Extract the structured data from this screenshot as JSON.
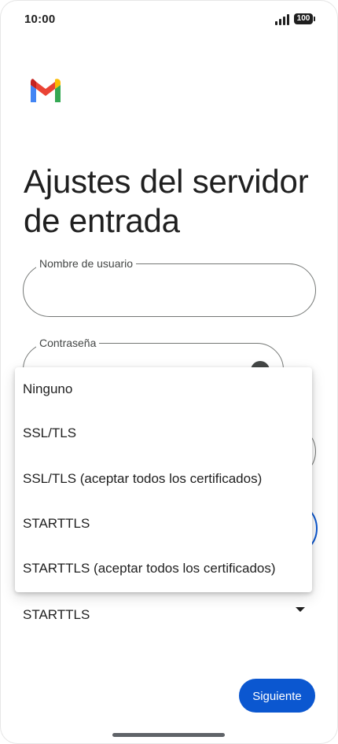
{
  "status_bar": {
    "time": "10:00",
    "battery": "100"
  },
  "header": {
    "logo_icon": "gmail-logo-icon",
    "title": "Ajustes del servidor de entrada"
  },
  "form": {
    "username_label": "Nombre de usuario",
    "username_value": "",
    "password_label": "Contraseña",
    "password_value": "",
    "security_selected": "STARTTLS"
  },
  "dropdown": {
    "options": [
      "Ninguno",
      "SSL/TLS",
      "SSL/TLS (aceptar todos los certificados)",
      "STARTTLS",
      "STARTTLS (aceptar todos los certificados)"
    ]
  },
  "actions": {
    "next_label": "Siguiente"
  },
  "colors": {
    "primary": "#0b57d0",
    "outline": "#747775",
    "text": "#1f1f1f"
  }
}
